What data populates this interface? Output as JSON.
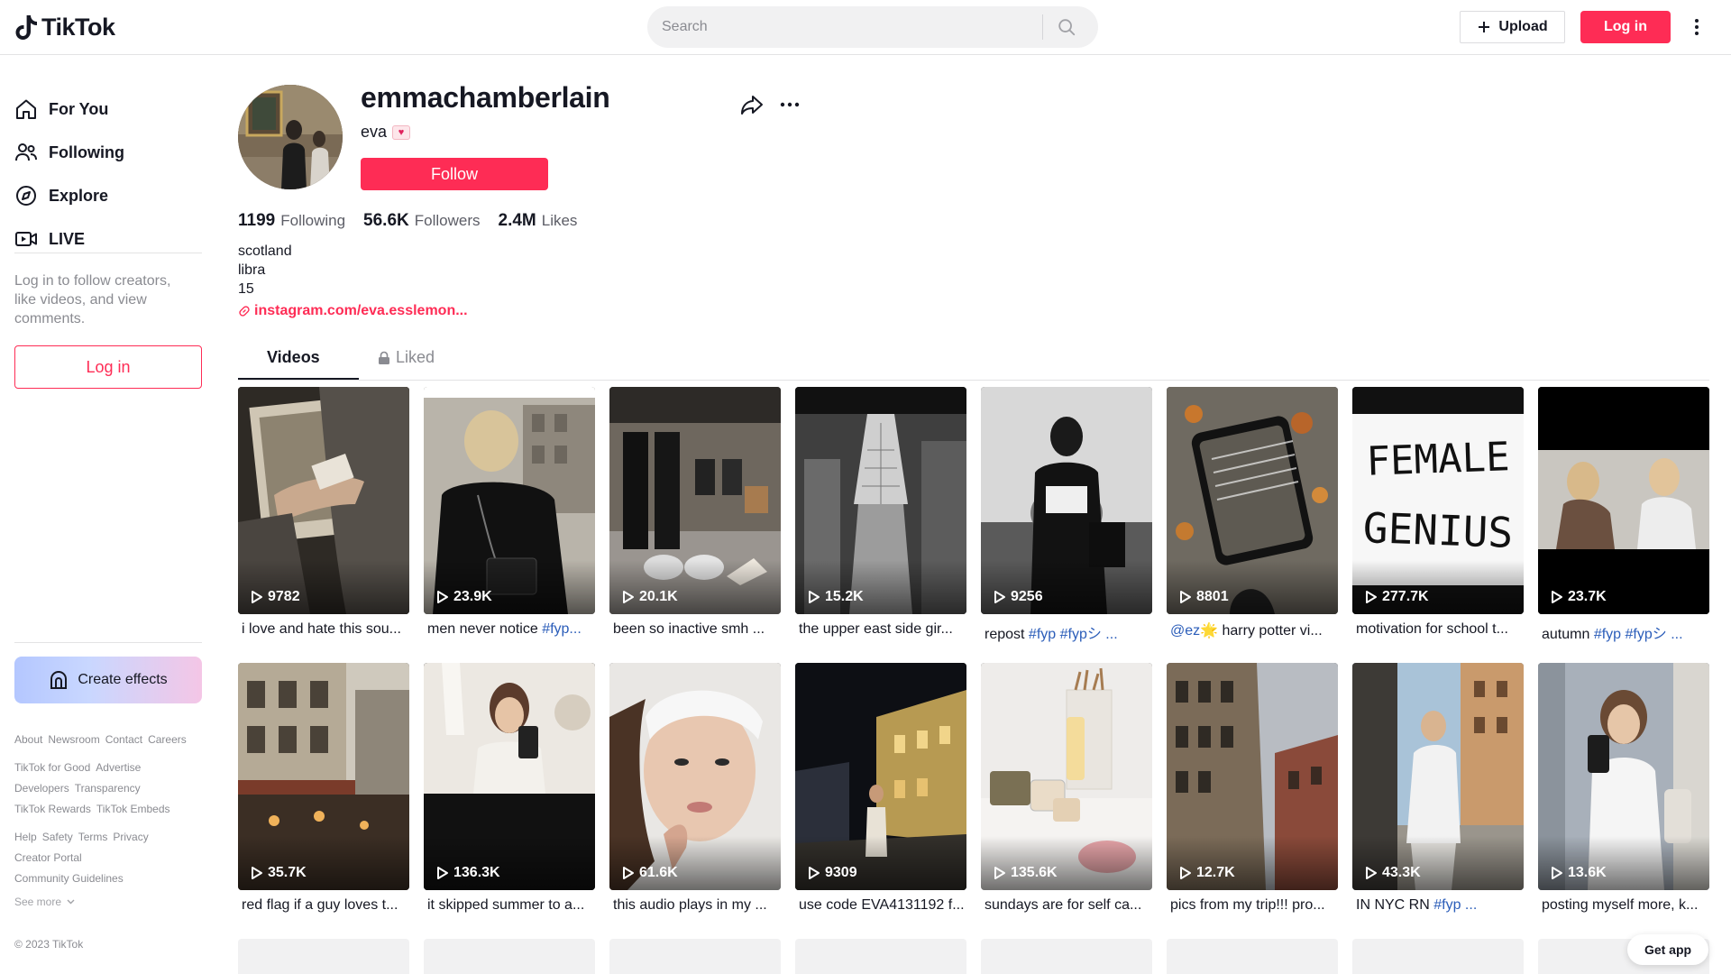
{
  "header": {
    "logo_text": "TikTok",
    "search_placeholder": "Search",
    "upload_label": "Upload",
    "login_label": "Log in"
  },
  "sidebar": {
    "nav": [
      {
        "label": "For You",
        "icon": "home-icon"
      },
      {
        "label": "Following",
        "icon": "users-icon"
      },
      {
        "label": "Explore",
        "icon": "compass-icon"
      },
      {
        "label": "LIVE",
        "icon": "live-icon"
      }
    ],
    "login_note": "Log in to follow creators, like videos, and view comments.",
    "login_label": "Log in",
    "effects_label": "Create effects",
    "footer": {
      "row1": [
        "About",
        "Newsroom",
        "Contact",
        "Careers"
      ],
      "row2": [
        "TikTok for Good",
        "Advertise"
      ],
      "row3": [
        "Developers",
        "Transparency"
      ],
      "row4": [
        "TikTok Rewards",
        "TikTok Embeds"
      ],
      "row5": [
        "Help",
        "Safety",
        "Terms",
        "Privacy"
      ],
      "row6": [
        "Creator Portal"
      ],
      "row7": [
        "Community Guidelines"
      ],
      "see_more": "See more",
      "copyright": "© 2023 TikTok"
    }
  },
  "profile": {
    "username": "emmachamberlain",
    "nickname": "eva",
    "follow_label": "Follow",
    "stats": {
      "following_count": "1199",
      "following_label": "Following",
      "followers_count": "56.6K",
      "followers_label": "Followers",
      "likes_count": "2.4M",
      "likes_label": "Likes"
    },
    "bio": [
      "scotland",
      "libra",
      "15"
    ],
    "link": "instagram.com/eva.esslemon..."
  },
  "tabs": {
    "videos": "Videos",
    "liked": "Liked"
  },
  "videos": [
    {
      "views": "9782",
      "caption": "i love and hate this sou...",
      "tags": ""
    },
    {
      "views": "23.9K",
      "caption": "men never notice ",
      "tags": "#fyp..."
    },
    {
      "views": "20.1K",
      "caption": "been so inactive smh ...",
      "tags": ""
    },
    {
      "views": "15.2K",
      "caption": "the upper east side gir...",
      "tags": ""
    },
    {
      "views": "9256",
      "caption": "repost ",
      "tags": "#fyp #fypシ ..."
    },
    {
      "views": "8801",
      "caption": " harry potter vi...",
      "tags": "@ez🌟"
    },
    {
      "views": "277.7K",
      "caption": "motivation for school t...",
      "tags": ""
    },
    {
      "views": "23.7K",
      "caption": "autumn ",
      "tags": "#fyp #fypシ ..."
    },
    {
      "views": "35.7K",
      "caption": "red flag if a guy loves t...",
      "tags": ""
    },
    {
      "views": "136.3K",
      "caption": "it skipped summer to a...",
      "tags": ""
    },
    {
      "views": "61.6K",
      "caption": "this audio plays in my ...",
      "tags": ""
    },
    {
      "views": "9309",
      "caption": "use code EVA4131192 f...",
      "tags": ""
    },
    {
      "views": "135.6K",
      "caption": "sundays are for self ca...",
      "tags": ""
    },
    {
      "views": "12.7K",
      "caption": "pics from my trip!!! pro...",
      "tags": ""
    },
    {
      "views": "43.3K",
      "caption": "IN NYC RN ",
      "tags": "#fyp ..."
    },
    {
      "views": "13.6K",
      "caption": "posting myself more, k...",
      "tags": ""
    }
  ],
  "thumb_texts": {
    "female_genius_line1": "FEMALE",
    "female_genius_line2": "GENIUS"
  },
  "get_app_label": "Get app",
  "colors": {
    "brand": "#fe2c55",
    "hashtag": "#2b5db9",
    "muted": "#8a8b91"
  }
}
